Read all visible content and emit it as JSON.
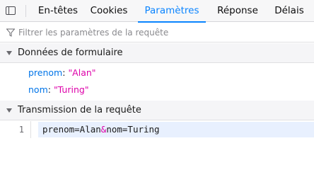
{
  "tabs": [
    {
      "label": "En-têtes",
      "active": false
    },
    {
      "label": "Cookies",
      "active": false
    },
    {
      "label": "Paramètres",
      "active": true
    },
    {
      "label": "Réponse",
      "active": false
    },
    {
      "label": "Délais",
      "active": false
    }
  ],
  "filter": {
    "placeholder": "Filtrer les paramètres de la requête",
    "value": ""
  },
  "form_section": {
    "title": "Données de formulaire",
    "params": [
      {
        "key": "prenom",
        "value": "\"Alan\""
      },
      {
        "key": "nom",
        "value": "\"Turing\""
      }
    ]
  },
  "payload_section": {
    "title": "Transmission de la requête",
    "line_number": "1",
    "code": {
      "part1": "prenom=Alan",
      "amp": "&",
      "part2": "nom=Turing"
    }
  },
  "colors": {
    "accent": "#0a84ff",
    "key": "#0074e8",
    "value": "#dd00a9"
  },
  "icons": {
    "panel": "sidebar-toggle-icon",
    "filter": "filter-icon",
    "twisty": "twisty-expanded-icon"
  }
}
